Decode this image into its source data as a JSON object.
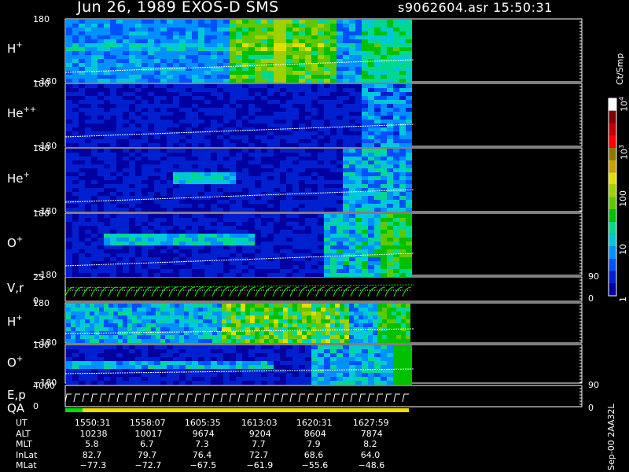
{
  "header": {
    "title": "Jun 26, 1989   EXOS-D SMS",
    "file_time": "s9062604.asr  15:50:31"
  },
  "panels": [
    {
      "name": "H",
      "charge": "+",
      "top": "180",
      "bottom": "−180"
    },
    {
      "name": "He",
      "charge": "++",
      "top": "180",
      "bottom": "−180"
    },
    {
      "name": "He",
      "charge": "+",
      "top": "180",
      "bottom": "−180"
    },
    {
      "name": "O",
      "charge": "+",
      "top": "180",
      "bottom": "−180"
    },
    {
      "name": "V,r",
      "charge": "",
      "top": "25",
      "bottom": "0"
    },
    {
      "name": "H",
      "charge": "+",
      "top": "180",
      "bottom": "−180"
    },
    {
      "name": "O",
      "charge": "+",
      "top": "180",
      "bottom": "−180"
    },
    {
      "name": "E,p",
      "charge": "",
      "top": "4000",
      "bottom": "0"
    }
  ],
  "qa_label": "QA",
  "right_ticks": {
    "vr_top": "90",
    "vr_bottom": "0",
    "ep_top": "90",
    "ep_bottom": "0"
  },
  "colorbar": {
    "unit": "Ct/Smp",
    "ticks": [
      {
        "label": "1",
        "value": 1
      },
      {
        "label": "10",
        "value": 10
      },
      {
        "label": "100",
        "value": 100
      },
      {
        "label": "10",
        "sup": "3",
        "value": 1000
      },
      {
        "label": "10",
        "sup": "4",
        "value": 10000
      }
    ],
    "colors": [
      "#0000a0",
      "#0020d0",
      "#0050ff",
      "#0090ff",
      "#00c8d8",
      "#00d890",
      "#00c000",
      "#60c800",
      "#a0d000",
      "#e0e000",
      "#c8a000",
      "#8a7a00",
      "#ff0000",
      "#c00000",
      "#800000",
      "#ffffff"
    ]
  },
  "footer_note": "Sep-00  2AA32L",
  "ephemeris": {
    "labels": [
      "UT",
      "ALT",
      "MLT",
      "InLat",
      "MLat"
    ],
    "rows": [
      [
        "1550:31",
        "1558:07",
        "1605:35",
        "1613:03",
        "1620:31",
        "1627:59"
      ],
      [
        "10238",
        "10017",
        "9674",
        "9204",
        "8604",
        "7874"
      ],
      [
        "5.8",
        "6.7",
        "7.3",
        "7.7",
        "7.9",
        "8.2"
      ],
      [
        "82.7",
        "79.7",
        "76.4",
        "72.7",
        "68.6",
        "64.0"
      ],
      [
        "−77.3",
        "−72.7",
        "−67.5",
        "−61.9",
        "−55.6",
        "−48.6"
      ]
    ]
  }
}
